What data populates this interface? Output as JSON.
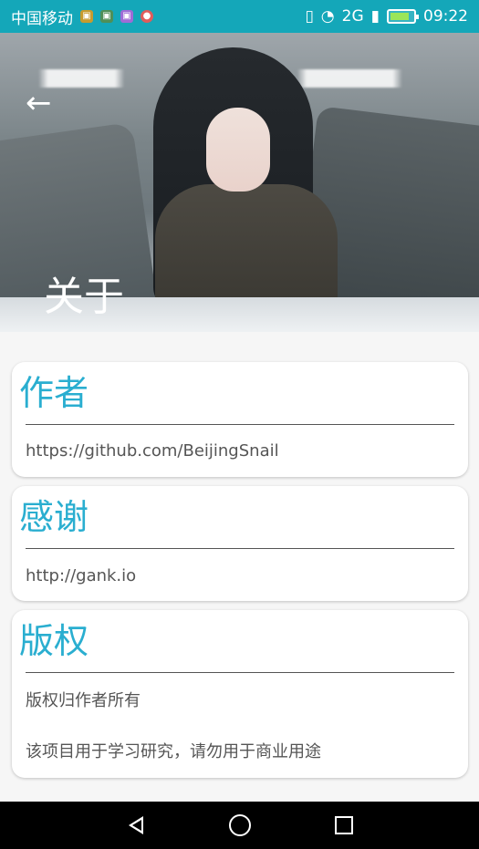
{
  "status_bar": {
    "carrier": "中国移动",
    "signal": "2G",
    "time": "09:22",
    "icons": [
      "app-icon",
      "app-icon",
      "app-icon",
      "app-icon",
      "vibrate-icon",
      "wifi-icon",
      "signal-icon",
      "battery-icon"
    ]
  },
  "header": {
    "title": "关于",
    "back_icon": "arrow-left-icon"
  },
  "cards": [
    {
      "title": "作者",
      "lines": [
        "https://github.com/BeijingSnail"
      ]
    },
    {
      "title": "感谢",
      "lines": [
        "http://gank.io"
      ]
    },
    {
      "title": "版权",
      "lines": [
        "版权归作者所有",
        "该项目用于学习研究，请勿用于商业用途"
      ]
    }
  ],
  "nav_bar": {
    "back_icon": "back-icon",
    "home_icon": "home-icon",
    "recent_icon": "recent-apps-icon"
  },
  "colors": {
    "status_bar": "#14a7b9",
    "accent": "#2aaed0",
    "card_bg": "#ffffff",
    "page_bg": "#f6f6f6",
    "nav_bg": "#000000"
  }
}
